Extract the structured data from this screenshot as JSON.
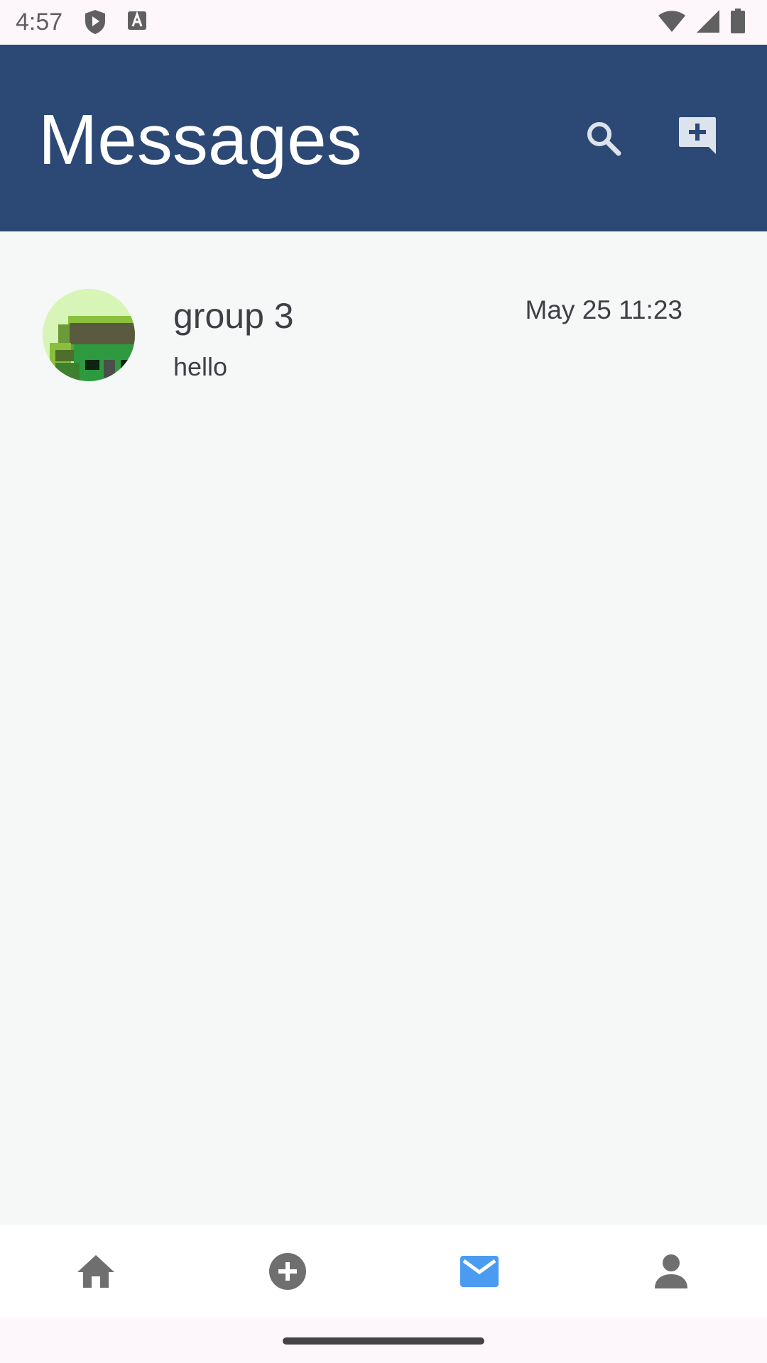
{
  "status_bar": {
    "time": "4:57",
    "icons": [
      "shield-play-icon",
      "keyboard-a-icon",
      "wifi-icon",
      "signal-icon",
      "battery-icon"
    ]
  },
  "header": {
    "title": "Messages",
    "background": "#2c4874",
    "actions": [
      "search-icon",
      "new-message-icon"
    ]
  },
  "conversations": [
    {
      "name": "group 3",
      "preview": "hello",
      "time": "May 25 11:23",
      "avatar": "pixel-art-avatar"
    }
  ],
  "bottom_nav": {
    "items": [
      {
        "icon": "home-icon",
        "active": false
      },
      {
        "icon": "add-circle-icon",
        "active": false
      },
      {
        "icon": "mail-icon",
        "active": true
      },
      {
        "icon": "person-icon",
        "active": false
      }
    ],
    "active_color": "#4b9cf0",
    "inactive_color": "#6f6f6f"
  }
}
